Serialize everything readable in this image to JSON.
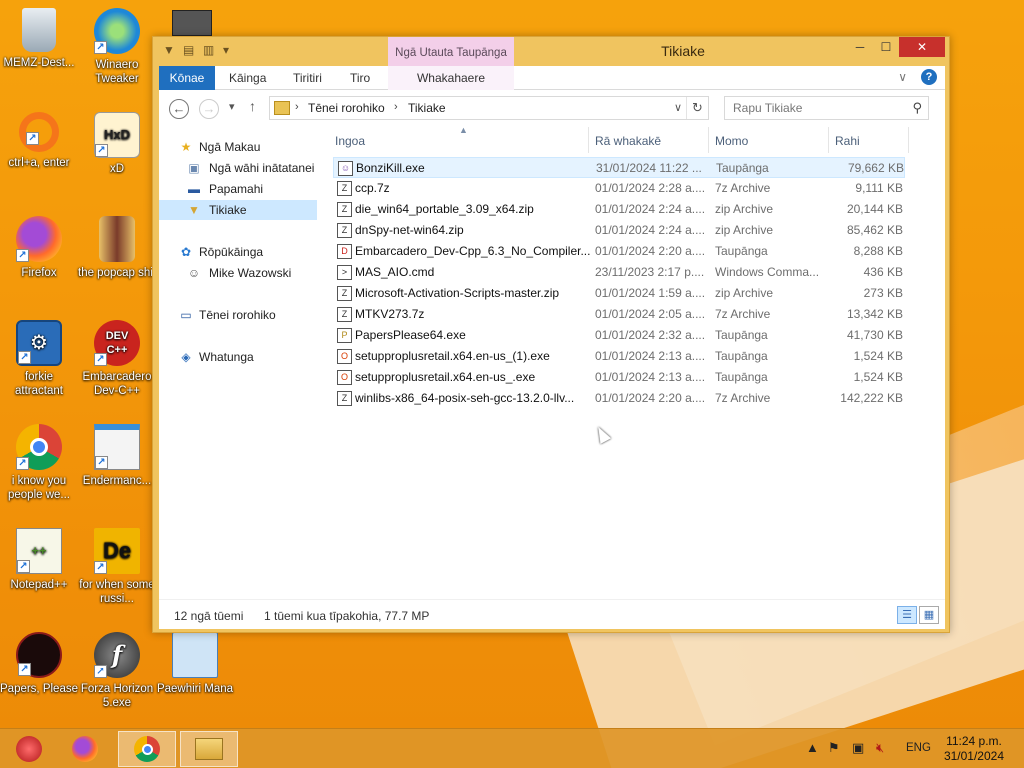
{
  "desktop": {
    "icons": [
      {
        "label": "MEMZ-Dest...",
        "icon": "recycle-bin-icon"
      },
      {
        "label": "Winaero Tweaker",
        "icon": "winaero-icon"
      },
      {
        "label": "ctrl+a, enter",
        "icon": "orange-ring-icon"
      },
      {
        "label": "xD",
        "icon": "hxd-icon"
      },
      {
        "label": "Firefox",
        "icon": "firefox-icon"
      },
      {
        "label": "the popcap shit",
        "icon": "popcap-folder-icon"
      },
      {
        "label": "forkie attractant",
        "icon": "settings-monitor-icon"
      },
      {
        "label": "Embarcadero Dev-C++",
        "icon": "devcpp-icon"
      },
      {
        "label": "i know you people we...",
        "icon": "chrome-icon"
      },
      {
        "label": "Endermanc...",
        "icon": "window-icon"
      },
      {
        "label": "Notepad++",
        "icon": "notepadpp-icon"
      },
      {
        "label": "for when some russi...",
        "icon": "de-icon"
      },
      {
        "label": "Papers, Please",
        "icon": "papers-please-icon"
      },
      {
        "label": "Forza Horizon 5.exe",
        "icon": "flash-icon"
      },
      {
        "label": "Paewhiri Mana",
        "icon": "control-panel-icon"
      }
    ]
  },
  "window": {
    "title": "Tikiake",
    "context_tab_group": "Ngā Utauta Taupānga",
    "ribbon_tabs": {
      "file": "Kōnae",
      "home": "Kāinga",
      "share": "Tiritiri",
      "view": "Tiro",
      "manage": "Whakahaere"
    },
    "address": {
      "crumb1": "Tēnei rorohiko",
      "crumb2": "Tikiake"
    },
    "search_placeholder": "Rapu Tikiake",
    "nav": {
      "quick_access": "Ngā Makau",
      "recent_places": "Ngā wāhi inātatanei",
      "desktop": "Papamahi",
      "downloads": "Tikiake",
      "homegroup": "Rōpūkāinga",
      "user": "Mike Wazowski",
      "this_pc": "Tēnei rorohiko",
      "network": "Whatunga"
    },
    "columns": {
      "name": "Ingoa",
      "date": "Rā whakakē",
      "type": "Momo",
      "size": "Rahi"
    },
    "files": [
      {
        "name": "BonziKill.exe",
        "date": "31/01/2024 11:22 ...",
        "type": "Taupānga",
        "size": "79,662 KB",
        "icon": "bonzi-icon"
      },
      {
        "name": "ccp.7z",
        "date": "01/01/2024 2:28 a....",
        "type": "7z Archive",
        "size": "9,111 KB",
        "icon": "archive-icon"
      },
      {
        "name": "die_win64_portable_3.09_x64.zip",
        "date": "01/01/2024 2:24 a....",
        "type": "zip Archive",
        "size": "20,144 KB",
        "icon": "archive-icon"
      },
      {
        "name": "dnSpy-net-win64.zip",
        "date": "01/01/2024 2:24 a....",
        "type": "zip Archive",
        "size": "85,462 KB",
        "icon": "archive-icon"
      },
      {
        "name": "Embarcadero_Dev-Cpp_6.3_No_Compiler...",
        "date": "01/01/2024 2:20 a....",
        "type": "Taupānga",
        "size": "8,288 KB",
        "icon": "devcpp-icon"
      },
      {
        "name": "MAS_AIO.cmd",
        "date": "23/11/2023 2:17 p....",
        "type": "Windows Comma...",
        "size": "436 KB",
        "icon": "cmd-icon"
      },
      {
        "name": "Microsoft-Activation-Scripts-master.zip",
        "date": "01/01/2024 1:59 a....",
        "type": "zip Archive",
        "size": "273 KB",
        "icon": "archive-icon"
      },
      {
        "name": "MTKV273.7z",
        "date": "01/01/2024 2:05 a....",
        "type": "7z Archive",
        "size": "13,342 KB",
        "icon": "archive-icon"
      },
      {
        "name": "PapersPlease64.exe",
        "date": "01/01/2024 2:32 a....",
        "type": "Taupānga",
        "size": "41,730 KB",
        "icon": "papers-please-icon"
      },
      {
        "name": "setupproplusretail.x64.en-us_(1).exe",
        "date": "01/01/2024 2:13 a....",
        "type": "Taupānga",
        "size": "1,524 KB",
        "icon": "office-icon"
      },
      {
        "name": "setupproplusretail.x64.en-us_.exe",
        "date": "01/01/2024 2:13 a....",
        "type": "Taupānga",
        "size": "1,524 KB",
        "icon": "office-icon"
      },
      {
        "name": "winlibs-x86_64-posix-seh-gcc-13.2.0-llv...",
        "date": "01/01/2024 2:20 a....",
        "type": "7z Archive",
        "size": "142,222 KB",
        "icon": "archive-icon"
      }
    ],
    "status": {
      "count": "12 ngā tūemi",
      "selection": "1 tūemi kua tīpakohia, 77.7 MP"
    }
  },
  "taskbar": {
    "language": "ENG",
    "time": "11:24 p.m.",
    "date": "31/01/2024"
  },
  "colors": {
    "accent": "#1f6fbf",
    "window_frame": "#f0c45f",
    "context_tab": "#f3cfe9",
    "close": "#c7302c"
  }
}
